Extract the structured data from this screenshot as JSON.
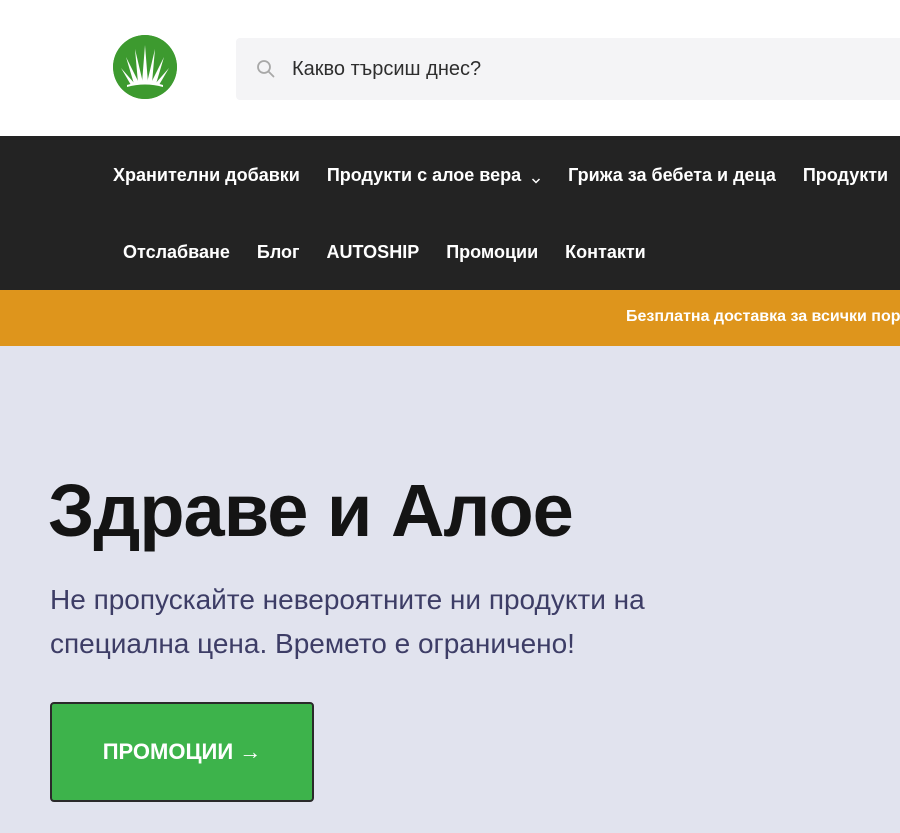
{
  "search": {
    "placeholder": "Какво търсиш днес?"
  },
  "nav": {
    "row1": [
      {
        "label": "Хранителни добавки"
      },
      {
        "label": "Продукти с алое вера"
      },
      {
        "label": "Грижа за бебета и деца"
      },
      {
        "label": "Продукти"
      }
    ],
    "row2": [
      {
        "label": "Отслабване"
      },
      {
        "label": "Блог"
      },
      {
        "label": "AUTOSHIP"
      },
      {
        "label": "Промоции"
      },
      {
        "label": "Контакти"
      }
    ]
  },
  "promo": {
    "text": "Безплатна доставка за всички поръчки"
  },
  "hero": {
    "title": "Здраве и Алое",
    "subtitle_line1": "Не пропускайте невероятните ни продукти на",
    "subtitle_line2": "специална цена. Времето е ограничено!",
    "cta_label": "ПРОМОЦИИ →"
  },
  "colors": {
    "nav_bg": "#232323",
    "promo_bg": "#de951c",
    "hero_bg": "#e1e3ee",
    "cta_bg": "#3db34b",
    "logo_green": "#3d9a2f"
  },
  "icons": {
    "logo": "aloe-plant-logo",
    "search": "search-icon",
    "dropdown": "chevron-down-icon"
  }
}
